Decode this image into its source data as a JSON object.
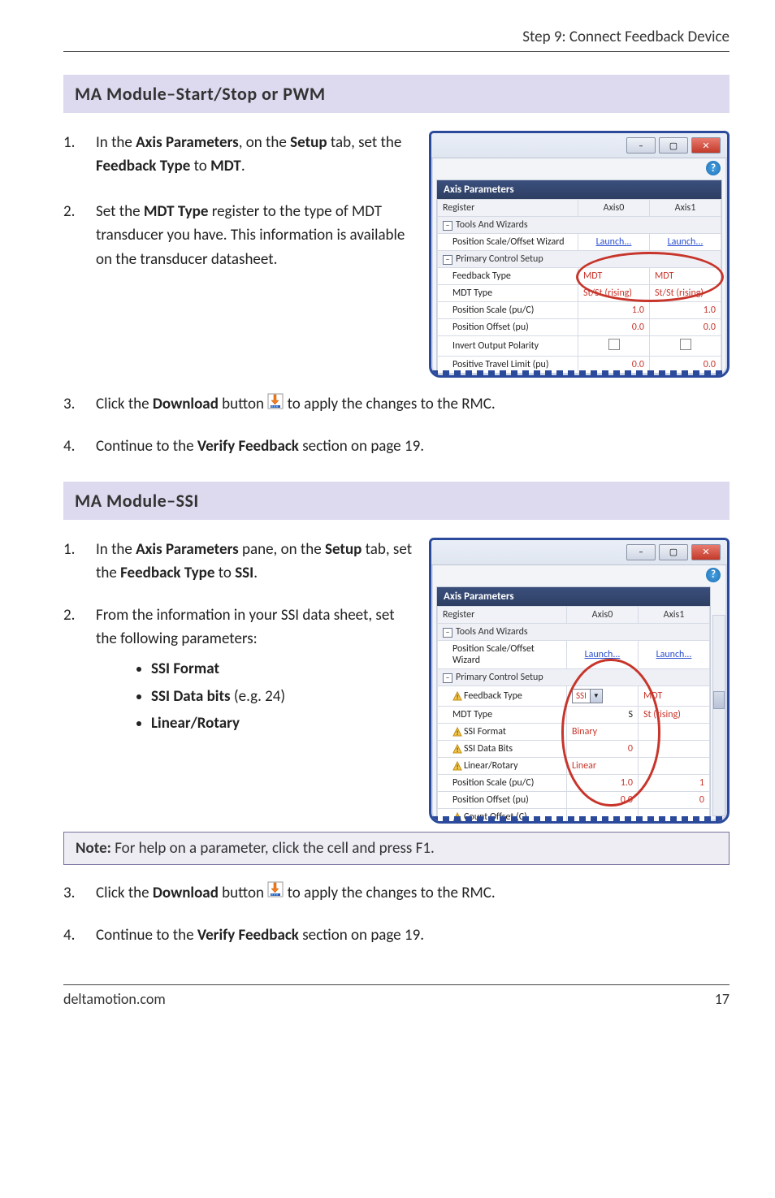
{
  "page": {
    "header": "Step 9: Connect Feedback Device",
    "footer_left": "deltamotion.com",
    "footer_right": "17"
  },
  "sectionA": {
    "title": "MA Module–Start/Stop or PWM",
    "step1_pre": "In the ",
    "step1_bold1": "Axis Parameters",
    "step1_mid1": ", on the ",
    "step1_bold2": "Setup",
    "step1_mid2": " tab, set the ",
    "step1_bold3": "Feedback Type",
    "step1_mid3": " to ",
    "step1_bold4": "MDT",
    "step1_end": ".",
    "step2_pre": "Set the ",
    "step2_bold1": "MDT Type",
    "step2_post": " register to the type of MDT transducer you have. This information is available on the transducer datasheet.",
    "step3_pre": "Click the ",
    "step3_bold1": "Download",
    "step3_mid": " button ",
    "step3_post": " to apply the changes to the RMC.",
    "step4_pre": "Continue to the ",
    "step4_bold1": "Verify Feedback",
    "step4_post": " section on page 19."
  },
  "sectionB": {
    "title": "MA Module–SSI",
    "step1_pre": "In the ",
    "step1_bold1": "Axis Parameters",
    "step1_mid1": " pane, on the ",
    "step1_bold2": "Setup",
    "step1_mid2": " tab, set the ",
    "step1_bold3": "Feedback Type",
    "step1_mid3": " to ",
    "step1_bold4": "SSI",
    "step1_end": ".",
    "step2": "From the information in your SSI data sheet, set the following parameters:",
    "bullet1": "SSI Format",
    "bullet2_b": "SSI Data bits",
    "bullet2_paren": " (e.g. 24)",
    "bullet3": "Linear/Rotary",
    "note_label": "Note:",
    "note_text": " For help on a parameter, click the cell and press F1.",
    "step3_pre": "Click the ",
    "step3_bold": "Download",
    "step3_mid": " button ",
    "step3_post": " to apply the changes to the RMC.",
    "step4_pre": "Continue to the ",
    "step4_bold": "Verify Feedback",
    "step4_post": " section on page 19."
  },
  "shotA": {
    "title": "Axis Parameters",
    "head_reg": "Register",
    "head_a0": "Axis0",
    "head_a1": "Axis1",
    "grp_tools": "Tools And Wizards",
    "row_wiz": "Position Scale/Offset Wizard",
    "launch": "Launch...",
    "grp_primary": "Primary Control Setup",
    "row_fb": "Feedback Type",
    "val_mdt": "MDT",
    "row_mdttype": "MDT Type",
    "val_stst": "St/St (rising)",
    "row_scale": "Position Scale (pu/C)",
    "val_10": "1.0",
    "row_off": "Position Offset (pu)",
    "val_00": "0.0",
    "row_inv": "Invert Output Polarity",
    "row_ptl": "Positive Travel Limit (pu)"
  },
  "shotB": {
    "title": "Axis Parameters",
    "head_reg": "Register",
    "head_a0": "Axis0",
    "head_a1": "Axis1",
    "grp_tools": "Tools And Wizards",
    "row_wiz": "Position Scale/Offset Wizard",
    "launch": "Launch...",
    "grp_primary": "Primary Control Setup",
    "row_fb": "Feedback Type",
    "val_ssi": "SSI",
    "val_mdt": "MDT",
    "row_mdttype": "MDT Type",
    "val_strising_short": "St (rising)",
    "label_s": "S",
    "row_ssifmt": "SSI Format",
    "val_binary": "Binary",
    "row_ssibits": "SSI Data Bits",
    "val_0": "0",
    "row_linrot": "Linear/Rotary",
    "val_linear": "Linear",
    "row_scale": "Position Scale (pu/C)",
    "val_10": "1.0",
    "val_1": "1",
    "row_off": "Position Offset (pu)",
    "val_00": "0.0",
    "val_0b": "0",
    "row_coff": "Count Offset (C)"
  }
}
